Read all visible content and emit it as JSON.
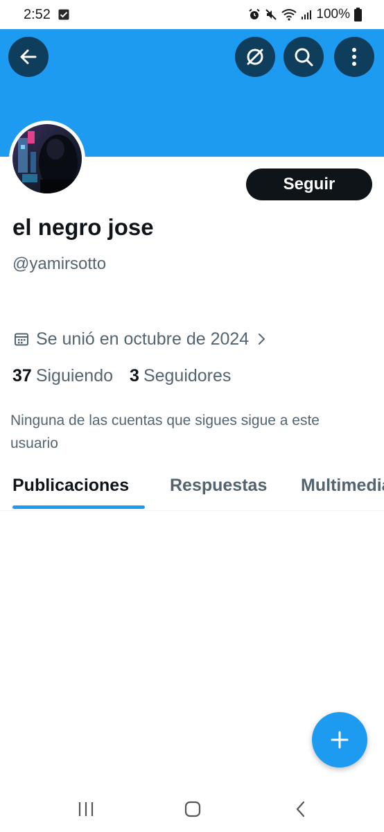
{
  "status_bar": {
    "time": "2:52",
    "battery": "100%",
    "icons": [
      "check-square-icon",
      "alarm-icon",
      "mute-icon",
      "wifi-icon",
      "signal-icon",
      "battery-icon"
    ]
  },
  "header": {
    "back_icon": "arrow-left-icon",
    "buttons": [
      "grok-icon",
      "search-icon",
      "more-vertical-icon"
    ],
    "banner_color": "#1d9bf0"
  },
  "profile": {
    "display_name": "el negro jose",
    "handle": "@yamirsotto",
    "follow_label": "Seguir",
    "joined": "Se unió en octubre de 2024",
    "following_count": "37",
    "following_label": "Siguiendo",
    "followers_count": "3",
    "followers_label": "Seguidores",
    "mutual_note": "Ninguna de las cuentas que sigues sigue a este usuario"
  },
  "tabs": [
    {
      "label": "Publicaciones",
      "active": true
    },
    {
      "label": "Respuestas",
      "active": false
    },
    {
      "label": "Multimedia",
      "active": false
    }
  ],
  "fab": {
    "icon": "plus-icon"
  },
  "nav_bar": [
    "recent-apps-icon",
    "home-icon",
    "back-icon"
  ],
  "colors": {
    "accent": "#1d9bf0",
    "primary_text": "#0f1419",
    "secondary_text": "#536471"
  }
}
